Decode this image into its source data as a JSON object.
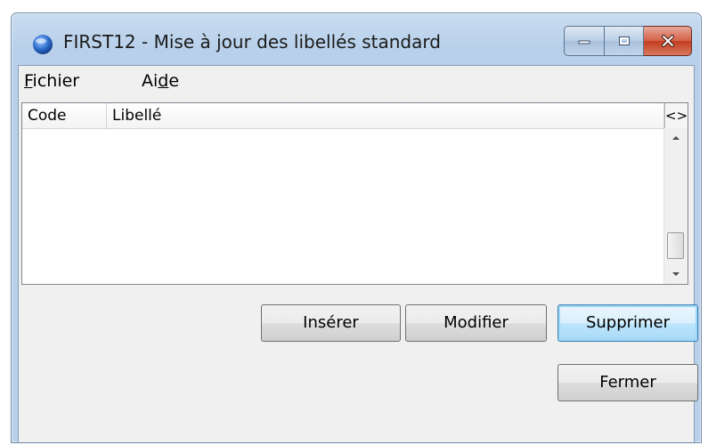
{
  "window": {
    "title": "FIRST12 - Mise à jour des libellés standard"
  },
  "menu": {
    "items": [
      {
        "prefix": "",
        "underlined": "F",
        "suffix": "ichier"
      },
      {
        "prefix": "Ai",
        "underlined": "d",
        "suffix": "e"
      }
    ]
  },
  "list": {
    "columns": [
      "Code",
      "Libellé"
    ],
    "toggle_label": "<>",
    "rows": []
  },
  "buttons": {
    "insert": "Insérer",
    "modify": "Modifier",
    "delete": "Supprimer",
    "close": "Fermer"
  },
  "colors": {
    "titlebar": "#b8d0ea",
    "close_button": "#c23d1f",
    "default_button_border": "#3c7fb1"
  }
}
